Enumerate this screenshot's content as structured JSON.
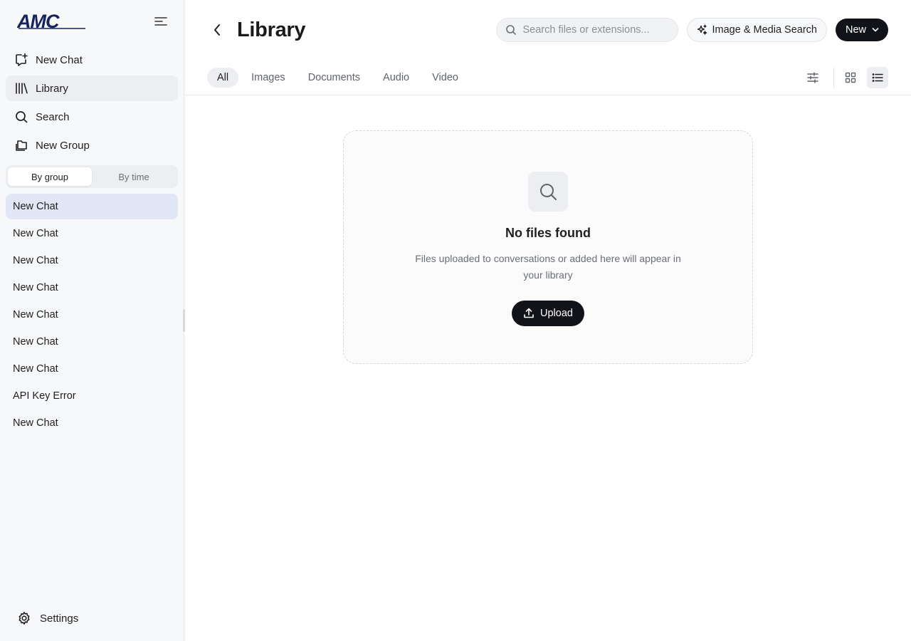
{
  "brand": {
    "logo_text": "AMC",
    "accent": "#16235c"
  },
  "sidebar": {
    "nav": [
      {
        "label": "New Chat",
        "icon": "new-chat-icon"
      },
      {
        "label": "Library",
        "icon": "library-icon"
      },
      {
        "label": "Search",
        "icon": "search-icon"
      },
      {
        "label": "New Group",
        "icon": "folder-icon"
      }
    ],
    "grouping": {
      "by_group": "By group",
      "by_time": "By time",
      "selected": "By group"
    },
    "chats": [
      "New Chat",
      "New Chat",
      "New Chat",
      "New Chat",
      "New Chat",
      "New Chat",
      "New Chat",
      "API Key Error",
      "New Chat"
    ],
    "settings_label": "Settings"
  },
  "header": {
    "title": "Library",
    "search_placeholder": "Search files or extensions...",
    "image_search_label": "Image & Media Search",
    "new_label": "New"
  },
  "tabs": [
    {
      "label": "All",
      "active": true
    },
    {
      "label": "Images"
    },
    {
      "label": "Documents"
    },
    {
      "label": "Audio"
    },
    {
      "label": "Video"
    }
  ],
  "empty_state": {
    "title": "No files found",
    "description": "Files uploaded to conversations or added here will appear in your library",
    "upload_label": "Upload"
  }
}
